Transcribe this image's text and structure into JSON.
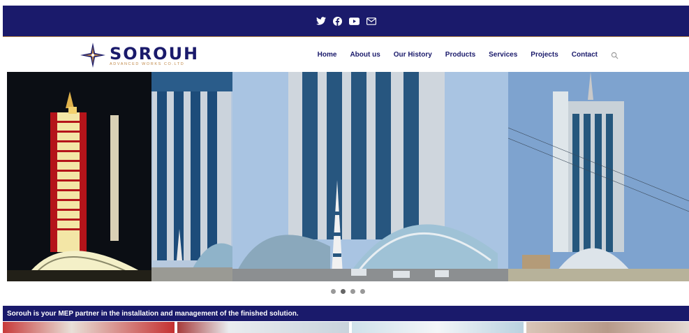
{
  "social": {
    "icons": [
      "twitter-icon",
      "facebook-icon",
      "youtube-icon",
      "email-icon"
    ]
  },
  "logo": {
    "brand": "SOROUH",
    "tagline": "ADVANCED WORKS CO.LTD"
  },
  "nav": {
    "items": [
      "Home",
      "About us",
      "Our History",
      "Products",
      "Services",
      "Projects",
      "Contact"
    ],
    "search_icon": "search-icon"
  },
  "slider": {
    "dots": 4,
    "active_dot": 1
  },
  "banner": {
    "text": "Sorouh is your MEP partner in the installation and management of the finished solution."
  },
  "colors": {
    "primary": "#1a1a6b",
    "accent": "#c08a4a"
  }
}
